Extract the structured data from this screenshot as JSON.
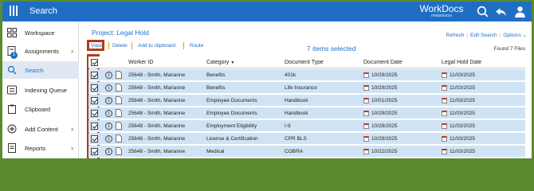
{
  "header": {
    "title": "Search",
    "brand_name": "WorkDocs",
    "brand_sub": "metasource"
  },
  "sidebar": {
    "items": [
      {
        "label": "Workspace",
        "icon": "workspace-icon",
        "chevron": ""
      },
      {
        "label": "Assignments",
        "icon": "assignments-icon",
        "chevron": "›",
        "badge": "1"
      },
      {
        "label": "Search",
        "icon": "search-icon",
        "chevron": ""
      },
      {
        "label": "Indexing Queue",
        "icon": "indexing-icon",
        "chevron": ""
      },
      {
        "label": "Clipboard",
        "icon": "clipboard-icon",
        "chevron": ""
      },
      {
        "label": "Add Content",
        "icon": "add-icon",
        "chevron": "›"
      },
      {
        "label": "Reports",
        "icon": "reports-icon",
        "chevron": "›"
      }
    ]
  },
  "main": {
    "project_title": "Project: Legal Hold",
    "links": {
      "refresh": "Refresh",
      "edit_search": "Edit Search",
      "options": "Options"
    },
    "actions": {
      "view": "View",
      "delete": "Delete",
      "add_to_clipboard": "Add to clipboard",
      "route": "Route"
    },
    "selected_count": "7 items selected",
    "found": "Found 7 Files"
  },
  "table": {
    "columns": {
      "worker_id": "Worker ID",
      "category": "Category",
      "document_type": "Document Type",
      "document_date": "Document Date",
      "legal_hold_date": "Legal Hold Date"
    },
    "rows": [
      {
        "worker": "25648 - Smith, Marianne",
        "category": "Benefits",
        "doc_type": "401k",
        "doc_date": "10/29/2025",
        "hold_date": "11/03/2025"
      },
      {
        "worker": "25648 - Smith, Marianne",
        "category": "Benefits",
        "doc_type": "Life Insurance",
        "doc_date": "10/29/2025",
        "hold_date": "11/03/2025"
      },
      {
        "worker": "25648 - Smith, Marianne",
        "category": "Employee Documents",
        "doc_type": "Handbook",
        "doc_date": "10/01/2025",
        "hold_date": "11/03/2025"
      },
      {
        "worker": "25648 - Smith, Marianne",
        "category": "Employee Documents",
        "doc_type": "Handbook",
        "doc_date": "10/29/2025",
        "hold_date": "11/03/2025"
      },
      {
        "worker": "25648 - Smith, Marianne",
        "category": "Employment Eligibility",
        "doc_type": "I-9",
        "doc_date": "10/29/2025",
        "hold_date": "11/03/2025"
      },
      {
        "worker": "25648 - Smith, Marianne",
        "category": "License & Certification",
        "doc_type": "CPR BLS",
        "doc_date": "10/29/2025",
        "hold_date": "11/03/2025"
      },
      {
        "worker": "25648 - Smith, Marianne",
        "category": "Medical",
        "doc_type": "COBRA",
        "doc_date": "10/22/2025",
        "hold_date": "11/03/2025"
      }
    ]
  },
  "colors": {
    "accent": "#1e6fc4",
    "row_selected": "#cfe3f4",
    "highlight": "#b23b1b",
    "frame": "#5c8a2e"
  }
}
